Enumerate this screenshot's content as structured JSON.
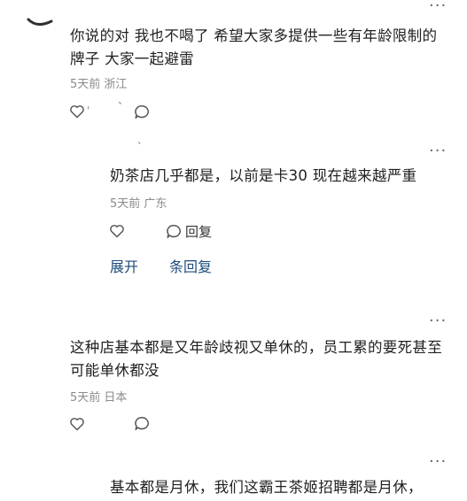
{
  "comments": [
    {
      "text": "你说的对 我也不喝了 希望大家多提供一些有年龄限制的牌子 大家一起避雷",
      "meta": "5天前 浙江",
      "more": "···"
    },
    {
      "text": "奶茶店几乎都是，以前是卡30 现在越来越严重",
      "meta": "5天前 广东",
      "reply_label": "回复",
      "more": "···"
    },
    {
      "text": "这种店基本都是又年龄歧视又单休的，员工累的要死甚至可能单休都没",
      "meta": "5天前 日本",
      "more": "···"
    },
    {
      "text": "基本都是月休，我们这霸王茶姬招聘都是月休，",
      "more": "···"
    }
  ],
  "thread": {
    "expand_label": "展开",
    "replies_label": "条回复"
  },
  "icons": {
    "like": "heart-outline-icon",
    "comment": "speech-bubble-icon",
    "more": "more-dots-icon"
  },
  "colors": {
    "text": "#1f1f1f",
    "meta": "#8a8a8a",
    "link": "#1e4b7a",
    "icon": "#555555"
  }
}
